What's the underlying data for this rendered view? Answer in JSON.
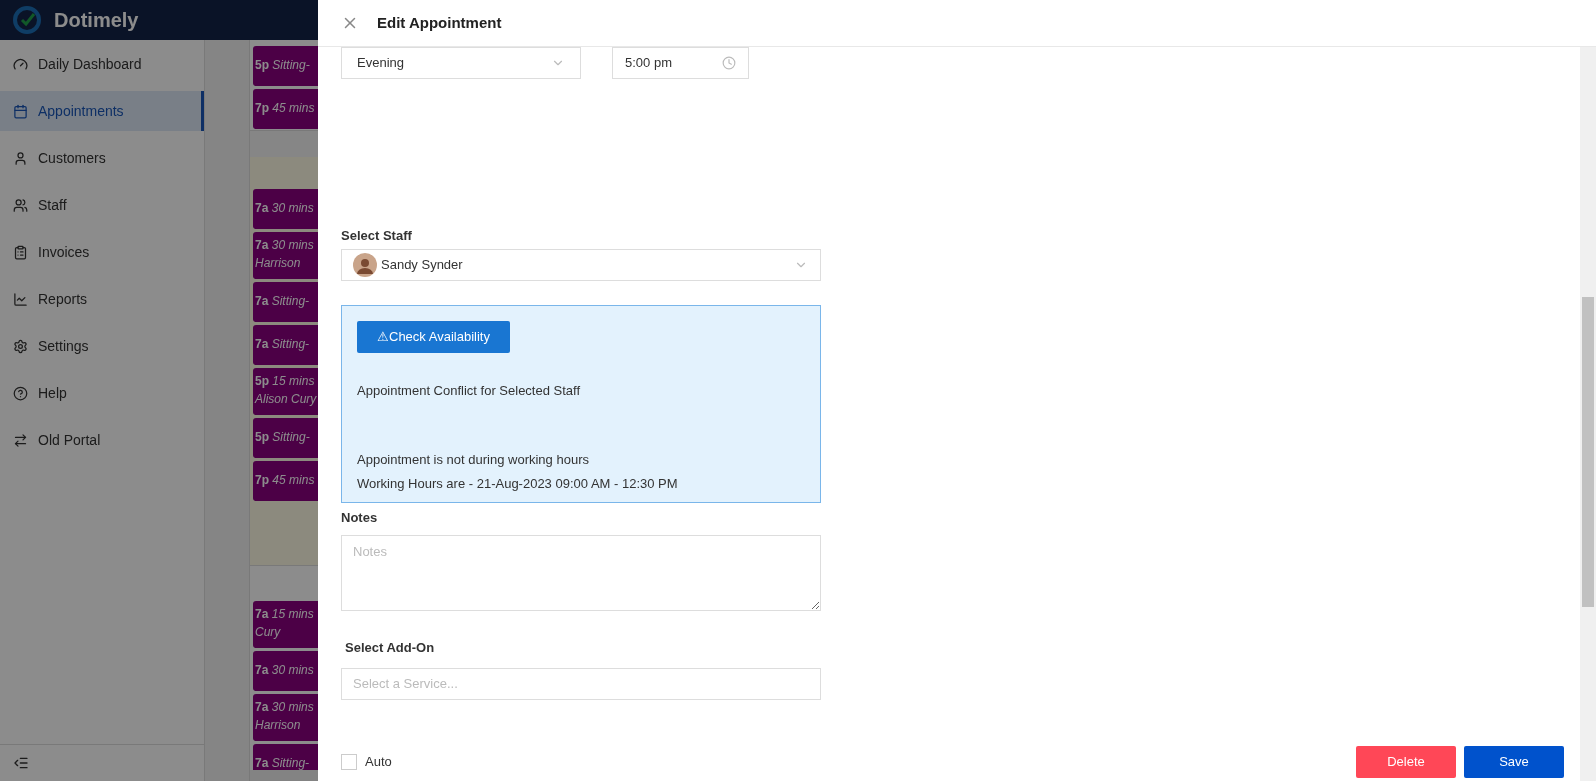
{
  "app": {
    "brand": "Dotimely"
  },
  "sidebar": {
    "items": [
      {
        "kind": "dashboard",
        "label": "Daily Dashboard",
        "selected": false
      },
      {
        "kind": "calendar",
        "label": "Appointments",
        "selected": true
      },
      {
        "kind": "user",
        "label": "Customers",
        "selected": false
      },
      {
        "kind": "users",
        "label": "Staff",
        "selected": false
      },
      {
        "kind": "invoice",
        "label": "Invoices",
        "selected": false
      },
      {
        "kind": "chart",
        "label": "Reports",
        "selected": false
      },
      {
        "kind": "settings",
        "label": "Settings",
        "selected": false
      },
      {
        "kind": "help",
        "label": "Help",
        "selected": false
      },
      {
        "kind": "swap",
        "label": "Old Portal",
        "selected": false
      }
    ]
  },
  "calendar": {
    "days": [
      {
        "events": [
          {
            "time": "5p",
            "text": "Sitting-"
          },
          {
            "time": "7p",
            "text": "45 mins"
          }
        ]
      },
      {
        "events": [
          {
            "time": "7a",
            "text": "30 mins"
          },
          {
            "time": "7a",
            "text": "30 mins",
            "line2": "Harrison"
          },
          {
            "time": "7a",
            "text": "Sitting-"
          },
          {
            "time": "7a",
            "text": "Sitting-"
          },
          {
            "time": "5p",
            "text": "15 mins",
            "line2": "Alison Cury"
          },
          {
            "time": "5p",
            "text": "Sitting-"
          },
          {
            "time": "7p",
            "text": "45 mins"
          }
        ]
      },
      {
        "events": [
          {
            "time": "7a",
            "text": "15 mins",
            "line2": "Cury"
          },
          {
            "time": "7a",
            "text": "30 mins"
          },
          {
            "time": "7a",
            "text": "30 mins",
            "line2": "Harrison"
          },
          {
            "time": "7a",
            "text": "Sitting-"
          }
        ]
      }
    ]
  },
  "drawer": {
    "title": "Edit Appointment",
    "period": {
      "value": "Evening"
    },
    "time": {
      "value": "5:00 pm"
    },
    "staff": {
      "label": "Select Staff",
      "value": "Sandy Synder"
    },
    "availability": {
      "button": "⚠Check Availability",
      "messages": [
        {
          "kind": "conflict",
          "text": "Appointment Conflict for Selected Staff"
        },
        {
          "kind": "hours",
          "text": "Appointment is not during working hours"
        },
        {
          "kind": "detail",
          "text": "Working Hours are - 21-Aug-2023 09:00 AM - 12:30 PM"
        }
      ]
    },
    "notes": {
      "label": "Notes",
      "placeholder": "Notes"
    },
    "addon": {
      "label": "Select Add-On",
      "placeholder": "Select a Service..."
    },
    "auto": {
      "label": "Auto",
      "checked": false
    },
    "buttons": [
      {
        "kind": "danger",
        "label": "Delete"
      },
      {
        "kind": "primary",
        "label": "Save"
      }
    ]
  }
}
